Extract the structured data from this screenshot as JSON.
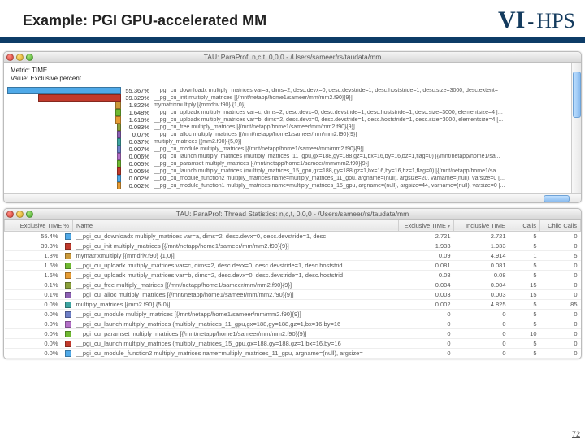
{
  "slide": {
    "title": "Example: PGI GPU-accelerated MM",
    "page": "72",
    "logo": {
      "vi": "VI",
      "dash": "-",
      "hps": "HPS"
    }
  },
  "win1": {
    "title": "TAU: ParaProf: n,c,t, 0,0,0 - /Users/sameer/rs/taudata/mm",
    "metric": "Metric: TIME",
    "value": "Value: Exclusive percent",
    "entries": [
      {
        "pct": "55.367%",
        "color": "#4fa9e8",
        "w": 140,
        "fname": "__pgi_cu_downloadx multiply_matrices var=a, dims=2, desc.devx=0, desc.devstride=1, desc.hoststride=1, desc.size=3000, desc.extent="
      },
      {
        "pct": "39.329%",
        "color": "#c13a2c",
        "w": 100,
        "fname": "__pgi_cu_init multiply_matrices [{/mnt/netapp/home1/sameer/mm/mm2.f90}{9}]"
      },
      {
        "pct": "1.822%",
        "color": "#cc9a3a",
        "w": 5,
        "fname": "mymatrixmultiply [{mmdriv.f90} {1,0}]"
      },
      {
        "pct": "1.648%",
        "color": "#6fb931",
        "w": 5,
        "fname": "__pgi_cu_uploadx multiply_matrices var=c, dims=2, desc.devx=0, desc.devstride=1, desc.hoststride=1, desc.size=3000, elementsize=4 [..."
      },
      {
        "pct": "1.618%",
        "color": "#e69b33",
        "w": 5,
        "fname": "__pgi_cu_uploadx multiply_matrices var=b, dims=2, desc.devx=0, desc.devstride=1, desc.hoststride=1, desc.size=3000, elementsize=4 [..."
      },
      {
        "pct": "0.083%",
        "color": "#8aa03a",
        "w": 3,
        "fname": "__pgi_cu_free multiply_matrices [{/mnt/netapp/home1/sameer/mm/mm2.f90}{9}]"
      },
      {
        "pct": "0.07%",
        "color": "#8c60b4",
        "w": 3,
        "fname": "__pgi_cu_alloc multiply_matrices [{/mnt/netapp/home1/sameer/mm/mm2.f90}{9}]"
      },
      {
        "pct": "0.037%",
        "color": "#3ea4a1",
        "w": 3,
        "fname": "multiply_matrices [{mm2.f90} {5,0}]"
      },
      {
        "pct": "0.007%",
        "color": "#6e7fc7",
        "w": 3,
        "fname": "__pgi_cu_module multiply_matrices [{/mnt/netapp/home1/sameer/mm/mm2.f90}{9}]"
      },
      {
        "pct": "0.006%",
        "color": "#b36fc7",
        "w": 3,
        "fname": "__pgi_cu_launch multiply_matrices (multiply_matrices_11_gpu,gx=188,gy=188,gz=1,bx=16,by=16,bz=1,flag=0) [{/mnt/netapp/home1/sa..."
      },
      {
        "pct": "0.005%",
        "color": "#6fb931",
        "w": 3,
        "fname": "__pgi_cu_paramset multiply_matrices [{/mnt/netapp/home1/sameer/mm/mm2.f90}{9}]"
      },
      {
        "pct": "0.005%",
        "color": "#c13a2c",
        "w": 3,
        "fname": "__pgi_cu_launch multiply_matrices (multiply_matrices_15_gpu,gx=188,gy=188,gz=1,bx=16,by=16,bz=1,flag=0) [{/mnt/netapp/home1/sa..."
      },
      {
        "pct": "0.002%",
        "color": "#4fa9e8",
        "w": 3,
        "fname": "__pgi_cu_module_function2 multiply_matrices name=multiply_matrices_11_gpu, argname=(null), argsize=20, varname=(null), varsize=0 [..."
      },
      {
        "pct": "0.002%",
        "color": "#e69b33",
        "w": 3,
        "fname": "__pgi_cu_module_function1 multiply_matrices name=multiply_matrices_15_gpu, argname=(null), argsize=44, varname=(null), varsize=0 [..."
      }
    ]
  },
  "win2": {
    "title": "TAU: ParaProf: Thread Statistics: n,c,t, 0,0,0 - /Users/sameer/rs/taudata/mm",
    "headers": {
      "pct": "Exclusive TIME %",
      "name": "Name",
      "et": "Exclusive TIME",
      "it": "Inclusive TIME",
      "calls": "Calls",
      "cc": "Child Calls"
    },
    "rows": [
      {
        "pct": "55.4%",
        "color": "#4fa9e8",
        "name": "__pgi_cu_downloadx multiply_matrices var=a, dims=2, desc.devx=0, desc.devstride=1, desc",
        "et": "2.721",
        "it": "2.721",
        "calls": "5",
        "cc": "0"
      },
      {
        "pct": "39.3%",
        "color": "#c13a2c",
        "name": "__pgi_cu_init multiply_matrices [{/mnt/netapp/home1/sameer/mm/mm2.f90}{9}]",
        "et": "1.933",
        "it": "1.933",
        "calls": "5",
        "cc": "0"
      },
      {
        "pct": "1.8%",
        "color": "#cc9a3a",
        "name": "mymatrixmultiply [{mmdriv.f90} {1,0}]",
        "et": "0.09",
        "it": "4.914",
        "calls": "1",
        "cc": "5"
      },
      {
        "pct": "1.6%",
        "color": "#6fb931",
        "name": "__pgi_cu_uploadx multiply_matrices var=c, dims=2, desc.devx=0, desc.devstride=1, desc.hoststrid",
        "et": "0.081",
        "it": "0.081",
        "calls": "5",
        "cc": "0"
      },
      {
        "pct": "1.6%",
        "color": "#e69b33",
        "name": "__pgi_cu_uploadx multiply_matrices var=b, dims=2, desc.devx=0, desc.devstride=1, desc.hoststrid",
        "et": "0.08",
        "it": "0.08",
        "calls": "5",
        "cc": "0"
      },
      {
        "pct": "0.1%",
        "color": "#8aa03a",
        "name": "__pgi_cu_free multiply_matrices [{/mnt/netapp/home1/sameer/mm/mm2.f90}{9}]",
        "et": "0.004",
        "it": "0.004",
        "calls": "15",
        "cc": "0"
      },
      {
        "pct": "0.1%",
        "color": "#8c60b4",
        "name": "__pgi_cu_alloc multiply_matrices [{/mnt/netapp/home1/sameer/mm/mm2.f90}{9}]",
        "et": "0.003",
        "it": "0.003",
        "calls": "15",
        "cc": "0"
      },
      {
        "pct": "0.0%",
        "color": "#3ea4a1",
        "name": "multiply_matrices [{mm2.f90} {5,0}]",
        "et": "0.002",
        "it": "4.825",
        "calls": "5",
        "cc": "85"
      },
      {
        "pct": "0.0%",
        "color": "#6e7fc7",
        "name": "__pgi_cu_module multiply_matrices [{/mnt/netapp/home1/sameer/mm/mm2.f90}{9}]",
        "et": "0",
        "it": "0",
        "calls": "5",
        "cc": "0"
      },
      {
        "pct": "0.0%",
        "color": "#b36fc7",
        "name": "__pgi_cu_launch multiply_matrices (multiply_matrices_11_gpu,gx=188,gy=188,gz=1,bx=16,by=16",
        "et": "0",
        "it": "0",
        "calls": "5",
        "cc": "0"
      },
      {
        "pct": "0.0%",
        "color": "#6fb931",
        "name": "__pgi_cu_paramset multiply_matrices [{/mnt/netapp/home1/sameer/mm/mm2.f90}{9}]",
        "et": "0",
        "it": "0",
        "calls": "10",
        "cc": "0"
      },
      {
        "pct": "0.0%",
        "color": "#c13a2c",
        "name": "__pgi_cu_launch multiply_matrices (multiply_matrices_15_gpu,gx=188,gy=188,gz=1,bx=16,by=16",
        "et": "0",
        "it": "0",
        "calls": "5",
        "cc": "0"
      },
      {
        "pct": "0.0%",
        "color": "#4fa9e8",
        "name": "__pgi_cu_module_function2 multiply_matrices name=multiply_matrices_11_gpu, argname=(null), argsize=",
        "et": "0",
        "it": "0",
        "calls": "5",
        "cc": "0"
      }
    ]
  }
}
